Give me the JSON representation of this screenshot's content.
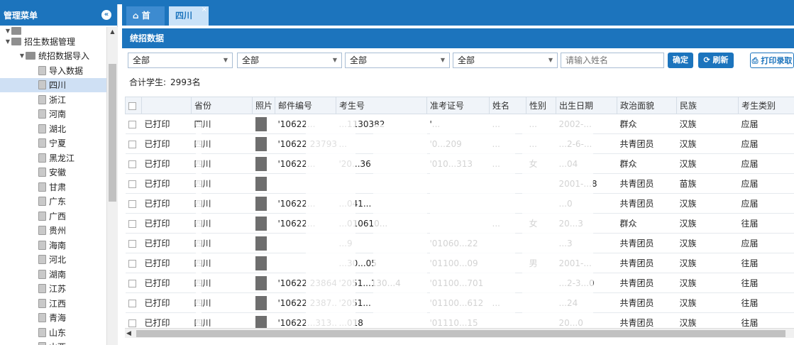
{
  "sidebar": {
    "title": "管理菜单",
    "collapse_icon": "double-chevron-left-icon",
    "tree": [
      {
        "label": "",
        "level": 0,
        "type": "folder"
      },
      {
        "label": "招生数据管理",
        "level": 0,
        "type": "folder"
      },
      {
        "label": "统招数据导入",
        "level": 1,
        "type": "folder"
      },
      {
        "label": "导入数据",
        "level": 2,
        "type": "page"
      },
      {
        "label": "四川",
        "level": 2,
        "type": "page",
        "selected": true
      },
      {
        "label": "浙江",
        "level": 2,
        "type": "page"
      },
      {
        "label": "河南",
        "level": 2,
        "type": "page"
      },
      {
        "label": "湖北",
        "level": 2,
        "type": "page"
      },
      {
        "label": "宁夏",
        "level": 2,
        "type": "page"
      },
      {
        "label": "黑龙江",
        "level": 2,
        "type": "page"
      },
      {
        "label": "安徽",
        "level": 2,
        "type": "page"
      },
      {
        "label": "甘肃",
        "level": 2,
        "type": "page"
      },
      {
        "label": "广东",
        "level": 2,
        "type": "page"
      },
      {
        "label": "广西",
        "level": 2,
        "type": "page"
      },
      {
        "label": "贵州",
        "level": 2,
        "type": "page"
      },
      {
        "label": "海南",
        "level": 2,
        "type": "page"
      },
      {
        "label": "河北",
        "level": 2,
        "type": "page"
      },
      {
        "label": "湖南",
        "level": 2,
        "type": "page"
      },
      {
        "label": "江苏",
        "level": 2,
        "type": "page"
      },
      {
        "label": "江西",
        "level": 2,
        "type": "page"
      },
      {
        "label": "青海",
        "level": 2,
        "type": "page"
      },
      {
        "label": "山东",
        "level": 2,
        "type": "page"
      },
      {
        "label": "山西",
        "level": 2,
        "type": "page"
      }
    ]
  },
  "tabs": {
    "home": "首页",
    "home_icon": "home-icon",
    "sichuan": "四川",
    "close": "×"
  },
  "panel": {
    "title": "统招数据"
  },
  "filters": {
    "select1": "全部",
    "select2": "全部",
    "select3": "全部",
    "select4": "全部",
    "name_placeholder": "请输入姓名",
    "confirm": "确定",
    "refresh": "刷新",
    "print": "打印录取"
  },
  "summary": {
    "label": "合计学生:",
    "count": "2993名"
  },
  "table": {
    "headers": [
      "",
      "",
      "省份",
      "照片",
      "邮件编号",
      "考生号",
      "准考证号",
      "姓名",
      "性别",
      "出生日期",
      "政治面貌",
      "民族",
      "考生类别"
    ],
    "rows": [
      {
        "status": "已打印",
        "prov": "四川",
        "mail": "'10622...",
        "ksh": "...1130382",
        "zkz": "'...",
        "name": "...",
        "sex": "...",
        "dob": "2002-...",
        "pol": "群众",
        "nation": "汉族",
        "type": "应届"
      },
      {
        "status": "已打印",
        "prov": "四川",
        "mail": "'10622 2379334",
        "ksh": "...",
        "zkz": "'0...209",
        "name": "...",
        "sex": "...",
        "dob": "...2-6-...",
        "pol": "共青团员",
        "nation": "汉族",
        "type": "应届"
      },
      {
        "status": "已打印",
        "prov": "四川",
        "mail": "'10622...",
        "ksh": "'20...36",
        "zkz": "'010...313",
        "name": "...",
        "sex": "女",
        "dob": "...04",
        "pol": "群众",
        "nation": "汉族",
        "type": "应届"
      },
      {
        "status": "已打印",
        "prov": "四川",
        "mail": "",
        "ksh": "",
        "zkz": "",
        "name": "",
        "sex": "",
        "dob": "2001-...8",
        "pol": "共青团员",
        "nation": "苗族",
        "type": "应届"
      },
      {
        "status": "已打印",
        "prov": "四川",
        "mail": "'10622...",
        "ksh": "...041...",
        "zkz": "",
        "name": "",
        "sex": "",
        "dob": "...0",
        "pol": "共青团员",
        "nation": "汉族",
        "type": "应届"
      },
      {
        "status": "已打印",
        "prov": "四川",
        "mail": "'10622...",
        "ksh": "...010610...",
        "zkz": "",
        "name": "...",
        "sex": "女",
        "dob": "20...3",
        "pol": "群众",
        "nation": "汉族",
        "type": "往届"
      },
      {
        "status": "已打印",
        "prov": "四川",
        "mail": "",
        "ksh": "...9",
        "zkz": "'01060...22",
        "name": "",
        "sex": "",
        "dob": "...3",
        "pol": "共青团员",
        "nation": "汉族",
        "type": "应届"
      },
      {
        "status": "已打印",
        "prov": "四川",
        "mail": "",
        "ksh": "...30...05",
        "zkz": "'01100...09",
        "name": "",
        "sex": "男",
        "dob": "2001-...",
        "pol": "共青团员",
        "nation": "汉族",
        "type": "往届"
      },
      {
        "status": "已打印",
        "prov": "四川",
        "mail": "'10622 23864",
        "ksh": "'2051...130...4",
        "zkz": "'01100...701",
        "name": "",
        "sex": "",
        "dob": "...2-3...0",
        "pol": "共青团员",
        "nation": "汉族",
        "type": "往届"
      },
      {
        "status": "已打印",
        "prov": "四川",
        "mail": "'10622 2387...",
        "ksh": "'2051...",
        "zkz": "'01100...612",
        "name": "...",
        "sex": "",
        "dob": "...24",
        "pol": "共青团员",
        "nation": "汉族",
        "type": "往届"
      },
      {
        "status": "已打印",
        "prov": "四川",
        "mail": "'10622...313...",
        "ksh": "...018",
        "zkz": "'01110...15",
        "name": "",
        "sex": "",
        "dob": "20...0",
        "pol": "共青团员",
        "nation": "汉族",
        "type": "往届"
      }
    ]
  },
  "colors": {
    "primary": "#1c74bd",
    "selected_row": "#cfe0f4"
  }
}
